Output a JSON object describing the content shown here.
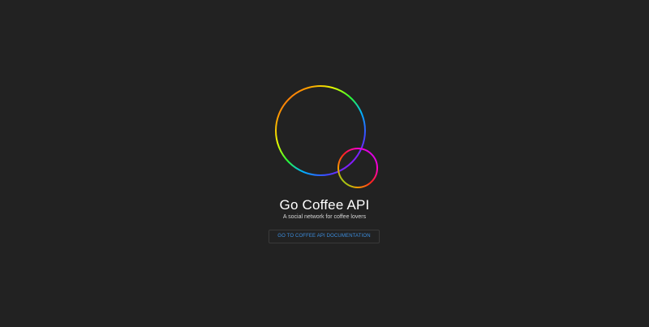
{
  "logo": {
    "icon": "coffee-rings-icon",
    "colors": [
      "#ff2020",
      "#ff9a00",
      "#e8ff00",
      "#2dff2d",
      "#00b3ff",
      "#3a4bff",
      "#b000ff",
      "#ff00cc"
    ]
  },
  "hero": {
    "title": "Go Coffee API",
    "subtitle": "A social network for coffee lovers",
    "button_label": "GO TO COFFEE API DOCUMENTATION"
  },
  "colors": {
    "background": "#222222",
    "title": "#ffffff",
    "link": "#3d8fe0"
  }
}
